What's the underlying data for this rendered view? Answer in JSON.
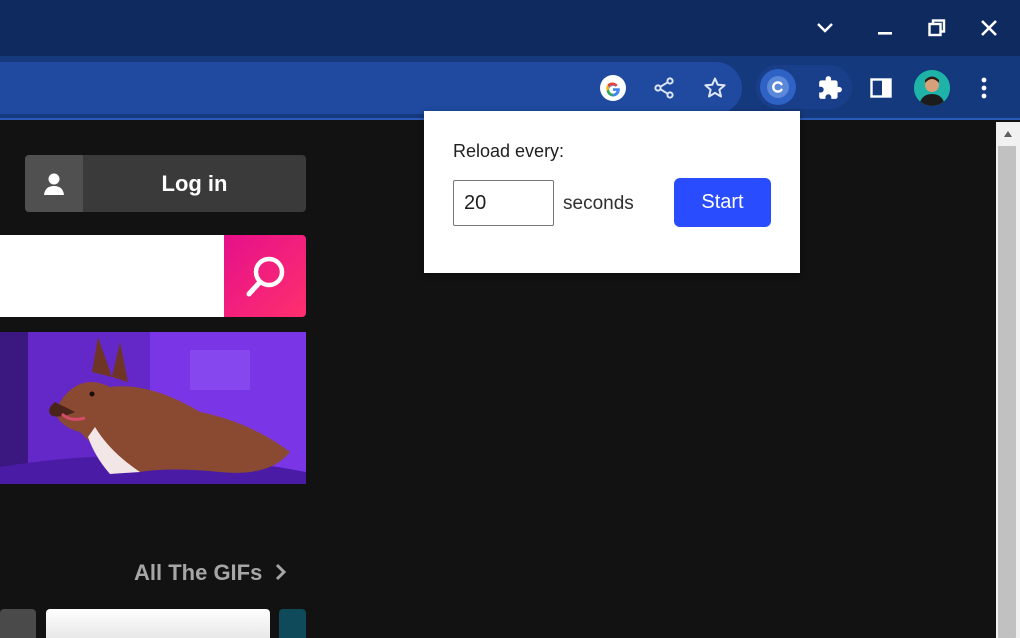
{
  "browser": {
    "window_controls": [
      "tab-search",
      "minimize",
      "restore",
      "close"
    ],
    "toolbar_icons": [
      "google-lens-icon",
      "share-icon",
      "bookmark-star-icon",
      "auto-refresh-extension-icon",
      "extensions-puzzle-icon",
      "side-panel-icon",
      "profile-avatar",
      "kebab-menu-icon"
    ]
  },
  "page": {
    "login_label": "Log in",
    "search_placeholder": "",
    "section_link": "All The GIFs",
    "colors": {
      "accent_pink": "#e5108a",
      "background": "#121212"
    }
  },
  "popup": {
    "label": "Reload every:",
    "interval_value": "20",
    "unit_label": "seconds",
    "start_label": "Start",
    "colors": {
      "button": "#2a4cff"
    }
  }
}
